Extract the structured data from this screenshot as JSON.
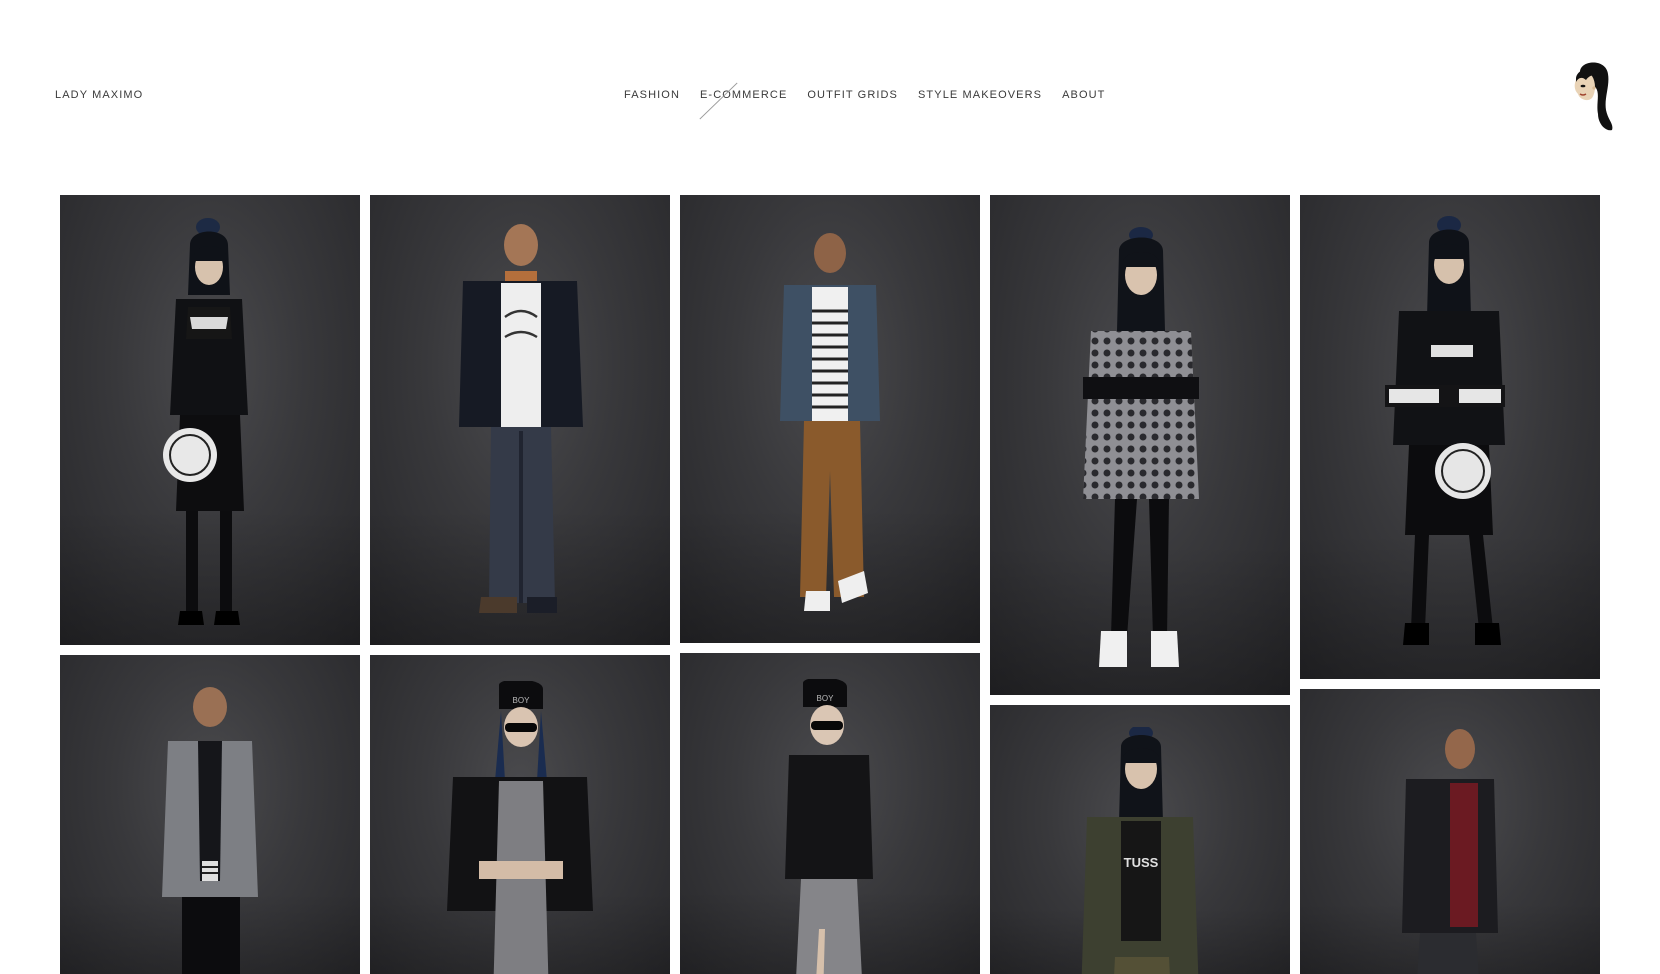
{
  "header": {
    "site_title": "LADY MAXIMO",
    "nav": [
      {
        "label": "FASHION",
        "active": false
      },
      {
        "label": "E-COMMERCE",
        "active": true
      },
      {
        "label": "OUTFIT GRIDS",
        "active": false
      },
      {
        "label": "STYLE MAKEOVERS",
        "active": false
      },
      {
        "label": "ABOUT",
        "active": false
      }
    ],
    "logo_icon": "lady-maximo-avatar-icon"
  },
  "gallery": {
    "tiles": [
      {
        "name": "look-01",
        "model": "woman",
        "outfit": "black vest, black shorts with white circular logo print"
      },
      {
        "name": "look-02",
        "model": "man",
        "outfit": "navy jacket with tan collar, white graphic tee, distressed jeans"
      },
      {
        "name": "look-03",
        "model": "man",
        "outfit": "denim jacket, striped shirt, tan chinos, white sneakers"
      },
      {
        "name": "look-04",
        "model": "woman",
        "outfit": "patterned dress, ripped black jeans, white high-top sneakers"
      },
      {
        "name": "look-05",
        "model": "woman",
        "outfit": "black vest with print sleeves, black shorts with white circular logo"
      },
      {
        "name": "look-06",
        "model": "man",
        "outfit": "grey bomber jacket, striped tee, black pants"
      },
      {
        "name": "look-07",
        "model": "woman",
        "outfit": "black beanie, sunglasses, black bomber, grey dress"
      },
      {
        "name": "look-08",
        "model": "woman",
        "outfit": "black beanie, sunglasses, black bomber, grey slit skirt"
      },
      {
        "name": "look-09",
        "model": "woman",
        "outfit": "olive parka, graphic tee, camo pants"
      },
      {
        "name": "look-10",
        "model": "man",
        "outfit": "black leather jacket, burgundy shirt"
      }
    ]
  }
}
